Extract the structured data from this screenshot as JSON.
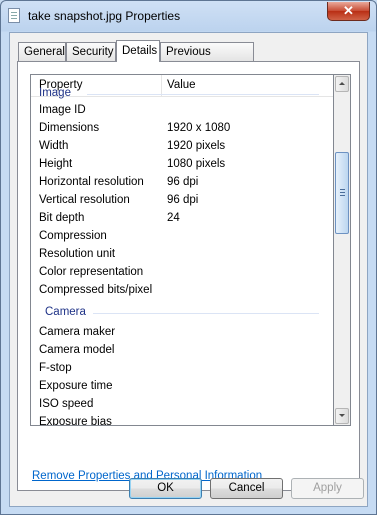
{
  "window": {
    "title": "take snapshot.jpg Properties",
    "close_glyph": "✕"
  },
  "tabs": [
    {
      "label": "General"
    },
    {
      "label": "Security"
    },
    {
      "label": "Details"
    },
    {
      "label": "Previous Versions"
    }
  ],
  "list": {
    "columns": {
      "property": "Property",
      "value": "Value"
    },
    "groups": {
      "image": "Image",
      "camera": "Camera"
    },
    "rows": [
      {
        "name": "Image ID",
        "value": ""
      },
      {
        "name": "Dimensions",
        "value": "1920 x 1080"
      },
      {
        "name": "Width",
        "value": "1920 pixels"
      },
      {
        "name": "Height",
        "value": "1080 pixels"
      },
      {
        "name": "Horizontal resolution",
        "value": "96 dpi"
      },
      {
        "name": "Vertical resolution",
        "value": "96 dpi"
      },
      {
        "name": "Bit depth",
        "value": "24"
      },
      {
        "name": "Compression",
        "value": ""
      },
      {
        "name": "Resolution unit",
        "value": ""
      },
      {
        "name": "Color representation",
        "value": ""
      },
      {
        "name": "Compressed bits/pixel",
        "value": ""
      },
      {
        "name": "Camera maker",
        "value": ""
      },
      {
        "name": "Camera model",
        "value": ""
      },
      {
        "name": "F-stop",
        "value": ""
      },
      {
        "name": "Exposure time",
        "value": ""
      },
      {
        "name": "ISO speed",
        "value": ""
      },
      {
        "name": "Exposure bias",
        "value": ""
      }
    ]
  },
  "link_text": "Remove Properties and Personal Information",
  "buttons": {
    "ok": "OK",
    "cancel": "Cancel",
    "apply": "Apply"
  },
  "icons": {
    "title": "document-icon",
    "scroll_up": "scroll-up-arrow-icon",
    "scroll_down": "scroll-down-arrow-icon"
  }
}
